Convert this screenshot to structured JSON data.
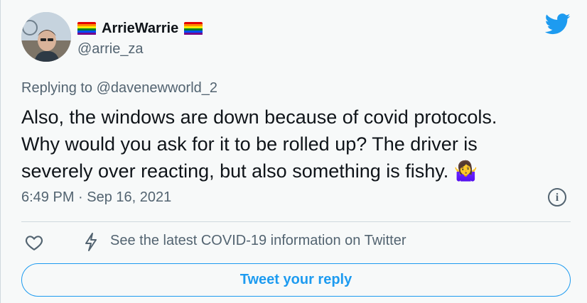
{
  "tweet": {
    "display_name": "ArrieWarrie",
    "handle": "@arrie_za",
    "replying_to": "Replying to @davenewworld_2",
    "text_line1": "Also, the windows are down because of covid protocols.",
    "text_line2": "Why would you ask for it to be rolled up? The driver is",
    "text_line3": "severely over reacting, but also something is fishy.",
    "text_emoji": "🤷‍♀️",
    "timestamp": "6:49 PM · Sep 16, 2021",
    "info_glyph": "i"
  },
  "actions": {
    "covid_notice": "See the latest COVID-19 information on Twitter",
    "reply_button": "Tweet your reply"
  },
  "icons": {
    "logo": "twitter-bird-icon",
    "like": "heart-icon",
    "covid": "lightning-icon",
    "info": "info-icon",
    "flag": "rainbow-flag-icon"
  },
  "colors": {
    "accent": "#1d9bf0",
    "secondary_text": "#536471",
    "background": "#f7f9f9"
  }
}
